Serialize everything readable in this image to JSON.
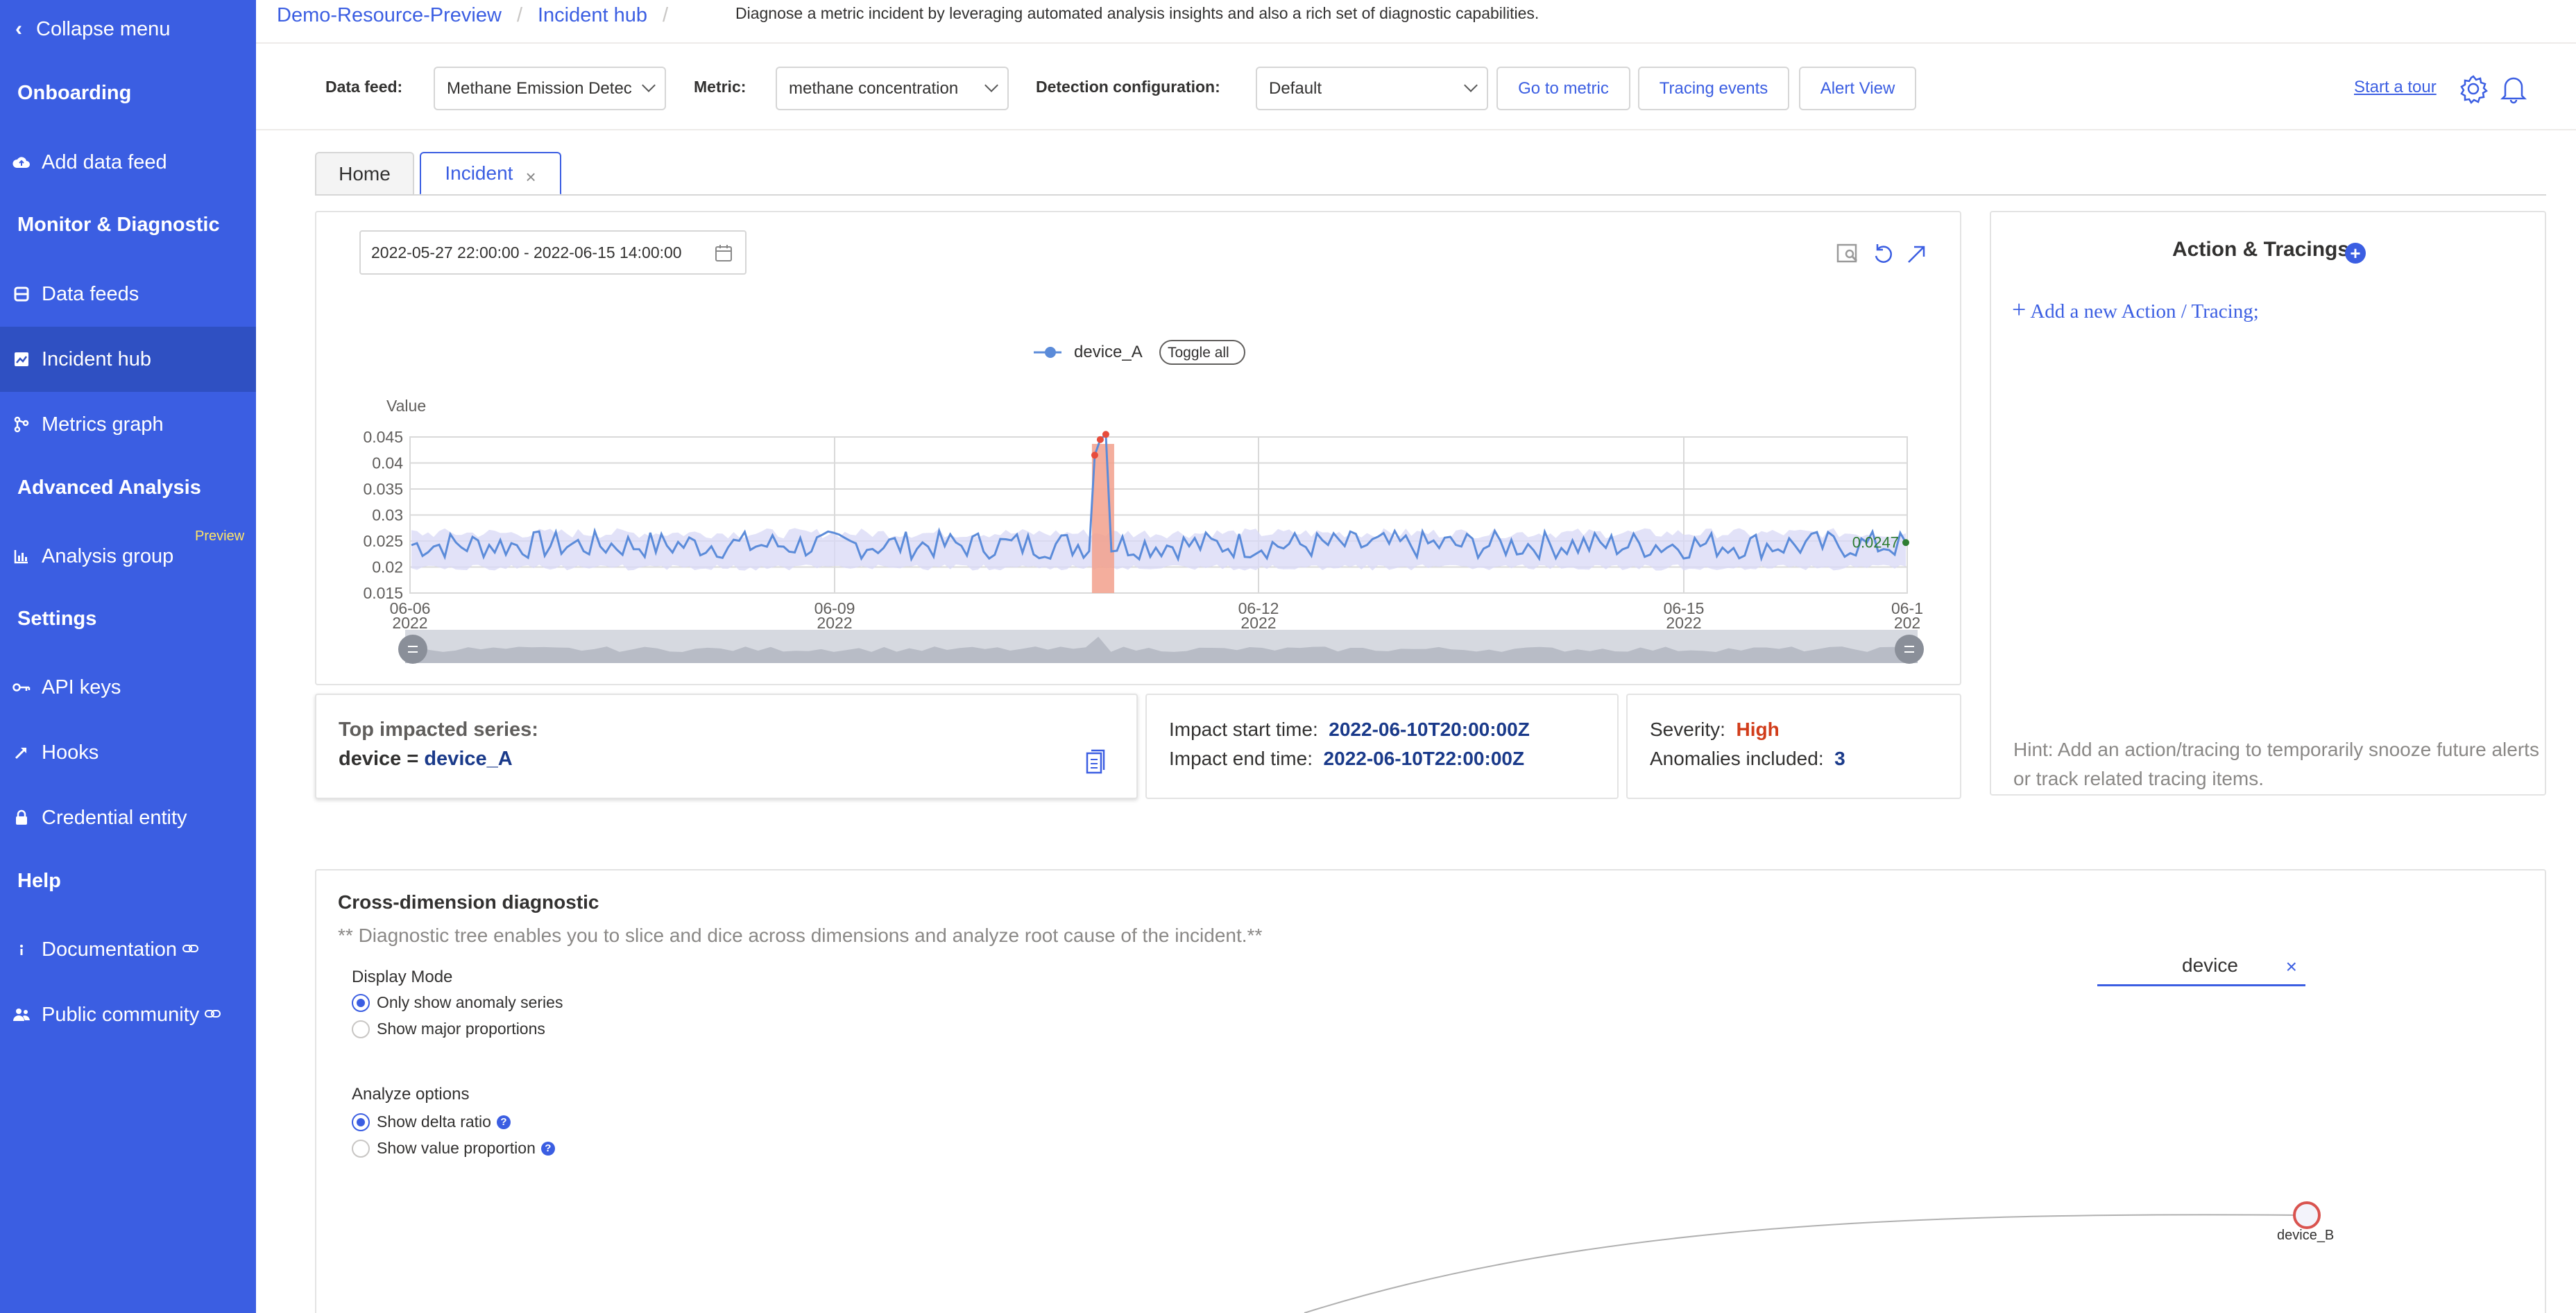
{
  "sidebar": {
    "collapse_label": "Collapse menu",
    "sections": [
      "Onboarding",
      "Monitor & Diagnostic",
      "Advanced Analysis",
      "Settings",
      "Help"
    ],
    "items": [
      {
        "label": "Add data feed",
        "icon": "cloud-upload-icon"
      },
      {
        "label": "Data feeds",
        "icon": "database-icon"
      },
      {
        "label": "Incident hub",
        "icon": "chart-icon",
        "active": true
      },
      {
        "label": "Metrics graph",
        "icon": "graph-icon"
      },
      {
        "label": "Analysis group",
        "icon": "bar-chart-icon",
        "badge": "Preview"
      },
      {
        "label": "API keys",
        "icon": "key-icon"
      },
      {
        "label": "Hooks",
        "icon": "hook-icon"
      },
      {
        "label": "Credential entity",
        "icon": "lock-icon"
      },
      {
        "label": "Documentation",
        "icon": "info-icon"
      },
      {
        "label": "Public community",
        "icon": "people-icon"
      }
    ]
  },
  "breadcrumb": {
    "items": [
      "Demo-Resource-Preview",
      "Incident hub"
    ],
    "description": "Diagnose a metric incident by leveraging automated analysis insights and also a rich set of diagnostic capabilities."
  },
  "toolbar": {
    "data_feed_label": "Data feed:",
    "data_feed_value": "Methane Emission Detec",
    "metric_label": "Metric:",
    "metric_value": "methane concentration",
    "detection_label": "Detection configuration:",
    "detection_value": "Default",
    "go_to_metric": "Go to metric",
    "tracing_events": "Tracing events",
    "alert_view": "Alert View",
    "start_tour": "Start a tour"
  },
  "tabs": [
    {
      "label": "Home"
    },
    {
      "label": "Incident",
      "active": true
    }
  ],
  "chart_panel": {
    "date_range": "2022-05-27 22:00:00 - 2022-06-15 14:00:00",
    "legend_series": "device_A",
    "toggle_all": "Toggle all"
  },
  "chart_data": {
    "type": "line",
    "ylabel": "Value",
    "yticks": [
      "0.045",
      "0.04",
      "0.035",
      "0.03",
      "0.025",
      "0.02",
      "0.015"
    ],
    "ylim": [
      0.015,
      0.045
    ],
    "xticks": [
      {
        "date": "06-06",
        "year": "2022"
      },
      {
        "date": "06-09",
        "year": "2022"
      },
      {
        "date": "06-12",
        "year": "2022"
      },
      {
        "date": "06-15",
        "year": "2022"
      },
      {
        "date": "06-1",
        "year": "202"
      }
    ],
    "series": [
      {
        "name": "device_A",
        "color": "#5b8bd9"
      }
    ],
    "anomaly_band_color": "#f2a08c",
    "anomaly_points": [
      0.0415,
      0.0445,
      0.0455
    ],
    "last_value_label": "0.0247",
    "expected_band_color": "#d8d8f5"
  },
  "impact": {
    "top_label": "Top impacted series:",
    "series_key": "device = ",
    "series_value": "device_A",
    "start_label": "Impact start time:",
    "start_value": "2022-06-10T20:00:00Z",
    "end_label": "Impact end time:",
    "end_value": "2022-06-10T22:00:00Z",
    "severity_label": "Severity:",
    "severity_value": "High",
    "anomalies_label": "Anomalies included:",
    "anomalies_value": "3"
  },
  "action_panel": {
    "title": "Action & Tracings",
    "add_label": "Add a new Action / Tracing;",
    "hint": "Hint: Add an action/tracing to temporarily snooze future alerts or track related tracing items."
  },
  "cross_dimension": {
    "title": "Cross-dimension diagnostic",
    "subtitle": "** Diagnostic tree enables you to slice and dice across dimensions and analyze root cause of the incident.**",
    "display_mode_label": "Display Mode",
    "display_options": [
      "Only show anomaly series",
      "Show major proportions"
    ],
    "analyze_label": "Analyze options",
    "analyze_options": [
      "Show delta ratio",
      "Show value proportion"
    ],
    "search_value": "device",
    "node_label": "device_B"
  },
  "colors": {
    "sidebar": "#3b5ee2",
    "accent": "#3b5ee2",
    "severity_high": "#d13c1a"
  }
}
